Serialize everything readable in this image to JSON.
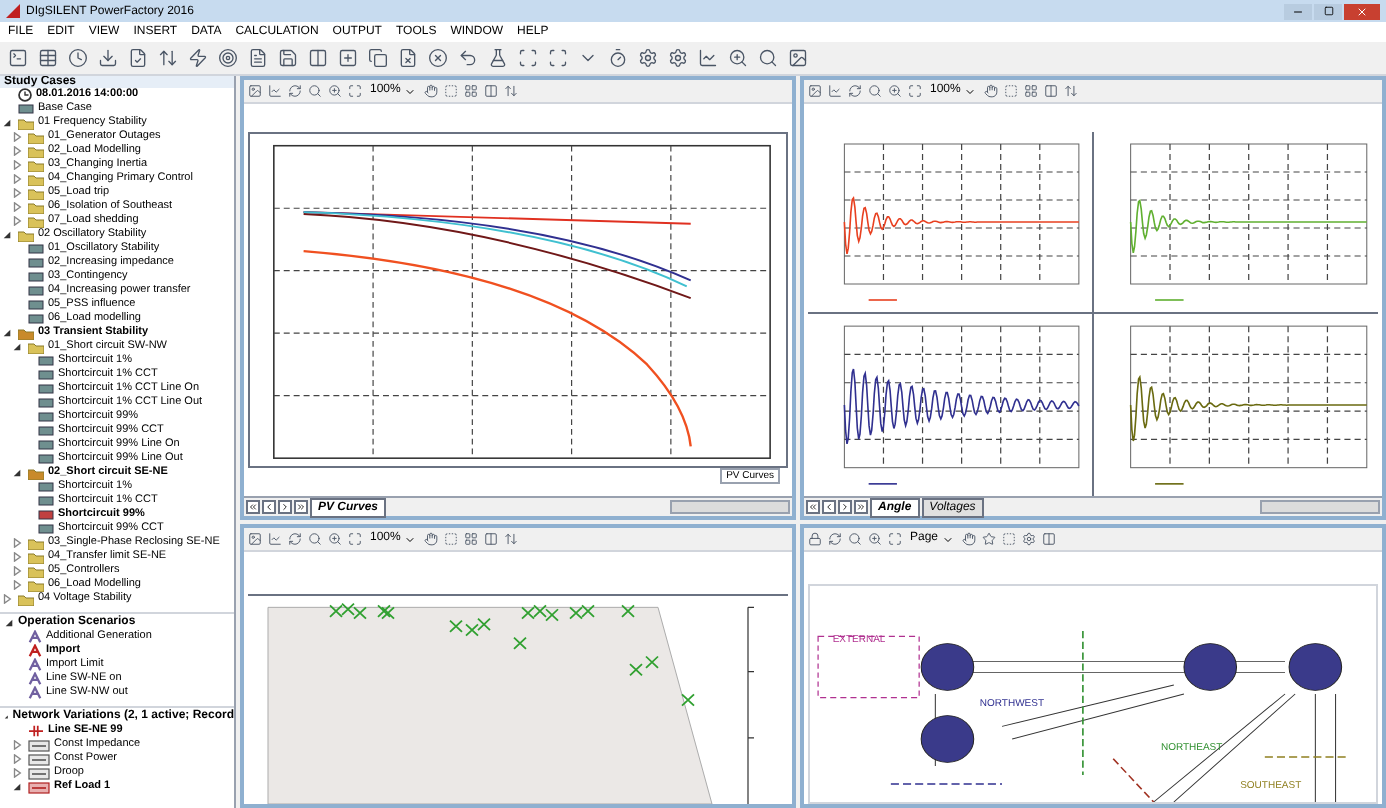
{
  "window": {
    "title": "DIgSILENT PowerFactory 2016"
  },
  "menu": [
    "FILE",
    "EDIT",
    "VIEW",
    "INSERT",
    "DATA",
    "CALCULATION",
    "OUTPUT",
    "TOOLS",
    "WINDOW",
    "HELP"
  ],
  "study_cases": {
    "title": "Study Cases",
    "items": [
      {
        "kind": "time",
        "label": "08.01.2016 14:00:00",
        "active": true
      },
      {
        "kind": "case",
        "label": "Base Case",
        "active": false
      },
      {
        "kind": "folder",
        "label": "01 Frequency Stability",
        "active": false,
        "expanded": true,
        "children": [
          {
            "kind": "folder",
            "label": "01_Generator Outages",
            "active": false,
            "expanded": false
          },
          {
            "kind": "folder",
            "label": "02_Load Modelling",
            "active": false,
            "expanded": false
          },
          {
            "kind": "folder",
            "label": "03_Changing Inertia",
            "active": false,
            "expanded": false
          },
          {
            "kind": "folder",
            "label": "04_Changing Primary Control",
            "active": false,
            "expanded": false
          },
          {
            "kind": "folder",
            "label": "05_Load trip",
            "active": false,
            "expanded": false
          },
          {
            "kind": "folder",
            "label": "06_Isolation of Southeast",
            "active": false,
            "expanded": false
          },
          {
            "kind": "folder",
            "label": "07_Load shedding",
            "active": false,
            "expanded": false
          }
        ]
      },
      {
        "kind": "folder",
        "label": "02 Oscillatory Stability",
        "active": false,
        "expanded": true,
        "children": [
          {
            "kind": "case",
            "label": "01_Oscillatory Stability",
            "active": false
          },
          {
            "kind": "case",
            "label": "02_Increasing impedance",
            "active": false
          },
          {
            "kind": "case",
            "label": "03_Contingency",
            "active": false
          },
          {
            "kind": "case",
            "label": "04_Increasing power transfer",
            "active": false
          },
          {
            "kind": "case",
            "label": "05_PSS influence",
            "active": false
          },
          {
            "kind": "case",
            "label": "06_Load modelling",
            "active": false
          }
        ]
      },
      {
        "kind": "folder",
        "label": "03 Transient Stability",
        "active": true,
        "expanded": true,
        "children": [
          {
            "kind": "folder",
            "label": "01_Short circuit SW-NW",
            "active": false,
            "expanded": true,
            "children": [
              {
                "kind": "case",
                "label": "Shortcircuit 1%",
                "active": false
              },
              {
                "kind": "case",
                "label": "Shortcircuit 1% CCT",
                "active": false
              },
              {
                "kind": "case",
                "label": "Shortcircuit 1% CCT Line On",
                "active": false
              },
              {
                "kind": "case",
                "label": "Shortcircuit 1% CCT Line Out",
                "active": false
              },
              {
                "kind": "case",
                "label": "Shortcircuit 99%",
                "active": false
              },
              {
                "kind": "case",
                "label": "Shortcircuit 99% CCT",
                "active": false
              },
              {
                "kind": "case",
                "label": "Shortcircuit 99% Line On",
                "active": false
              },
              {
                "kind": "case",
                "label": "Shortcircuit 99% Line Out",
                "active": false
              }
            ]
          },
          {
            "kind": "folder",
            "label": "02_Short circuit SE-NE",
            "active": true,
            "expanded": true,
            "children": [
              {
                "kind": "case",
                "label": "Shortcircuit 1%",
                "active": false
              },
              {
                "kind": "case",
                "label": "Shortcircuit 1% CCT",
                "active": false
              },
              {
                "kind": "case",
                "label": "Shortcircuit 99%",
                "active": true
              },
              {
                "kind": "case",
                "label": "Shortcircuit 99% CCT",
                "active": false
              }
            ]
          },
          {
            "kind": "folder",
            "label": "03_Single-Phase Reclosing SE-NE",
            "active": false,
            "expanded": false
          },
          {
            "kind": "folder",
            "label": "04_Transfer limit SE-NE",
            "active": false,
            "expanded": false
          },
          {
            "kind": "folder",
            "label": "05_Controllers",
            "active": false,
            "expanded": false
          },
          {
            "kind": "folder",
            "label": "06_Load Modelling",
            "active": false,
            "expanded": false
          }
        ]
      },
      {
        "kind": "folder",
        "label": "04 Voltage Stability",
        "active": false,
        "expanded": false
      }
    ]
  },
  "operation_scenarios": {
    "title": "Operation Scenarios",
    "items": [
      {
        "kind": "scenario",
        "label": "Additional Generation",
        "active": false
      },
      {
        "kind": "scenario",
        "label": "Import",
        "active": true
      },
      {
        "kind": "scenario",
        "label": "Import Limit",
        "active": false
      },
      {
        "kind": "scenario",
        "label": "Line SW-NE on",
        "active": false
      },
      {
        "kind": "scenario",
        "label": "Line SW-NW out",
        "active": false
      }
    ]
  },
  "network_variations": {
    "title": "Network Variations (2, 1 active; Record",
    "items": [
      {
        "kind": "variation",
        "label": "Line SE-NE 99",
        "active": true
      },
      {
        "kind": "stage",
        "label": "Const Impedance",
        "active": false,
        "expanded": false
      },
      {
        "kind": "stage",
        "label": "Const Power",
        "active": false,
        "expanded": false
      },
      {
        "kind": "stage",
        "label": "Droop",
        "active": false,
        "expanded": false
      },
      {
        "kind": "stage",
        "label": "Ref Load 1",
        "active": true,
        "expanded": true
      }
    ]
  },
  "panes": [
    {
      "kind": "pv",
      "zoom": "100%",
      "caption": "PV Curves",
      "tabs": [
        {
          "label": "PV Curves",
          "selected": true
        }
      ]
    },
    {
      "kind": "timeseries",
      "zoom": "100%",
      "tabs": [
        {
          "label": "Angle",
          "selected": true
        },
        {
          "label": "Voltages",
          "selected": false
        }
      ]
    },
    {
      "kind": "scatter",
      "zoom": "100%"
    },
    {
      "kind": "diagram",
      "zoom": "Page",
      "areas": [
        "EXTERNAL",
        "NORTHWEST",
        "NORTHEAST",
        "SOUTHEAST"
      ]
    }
  ]
}
